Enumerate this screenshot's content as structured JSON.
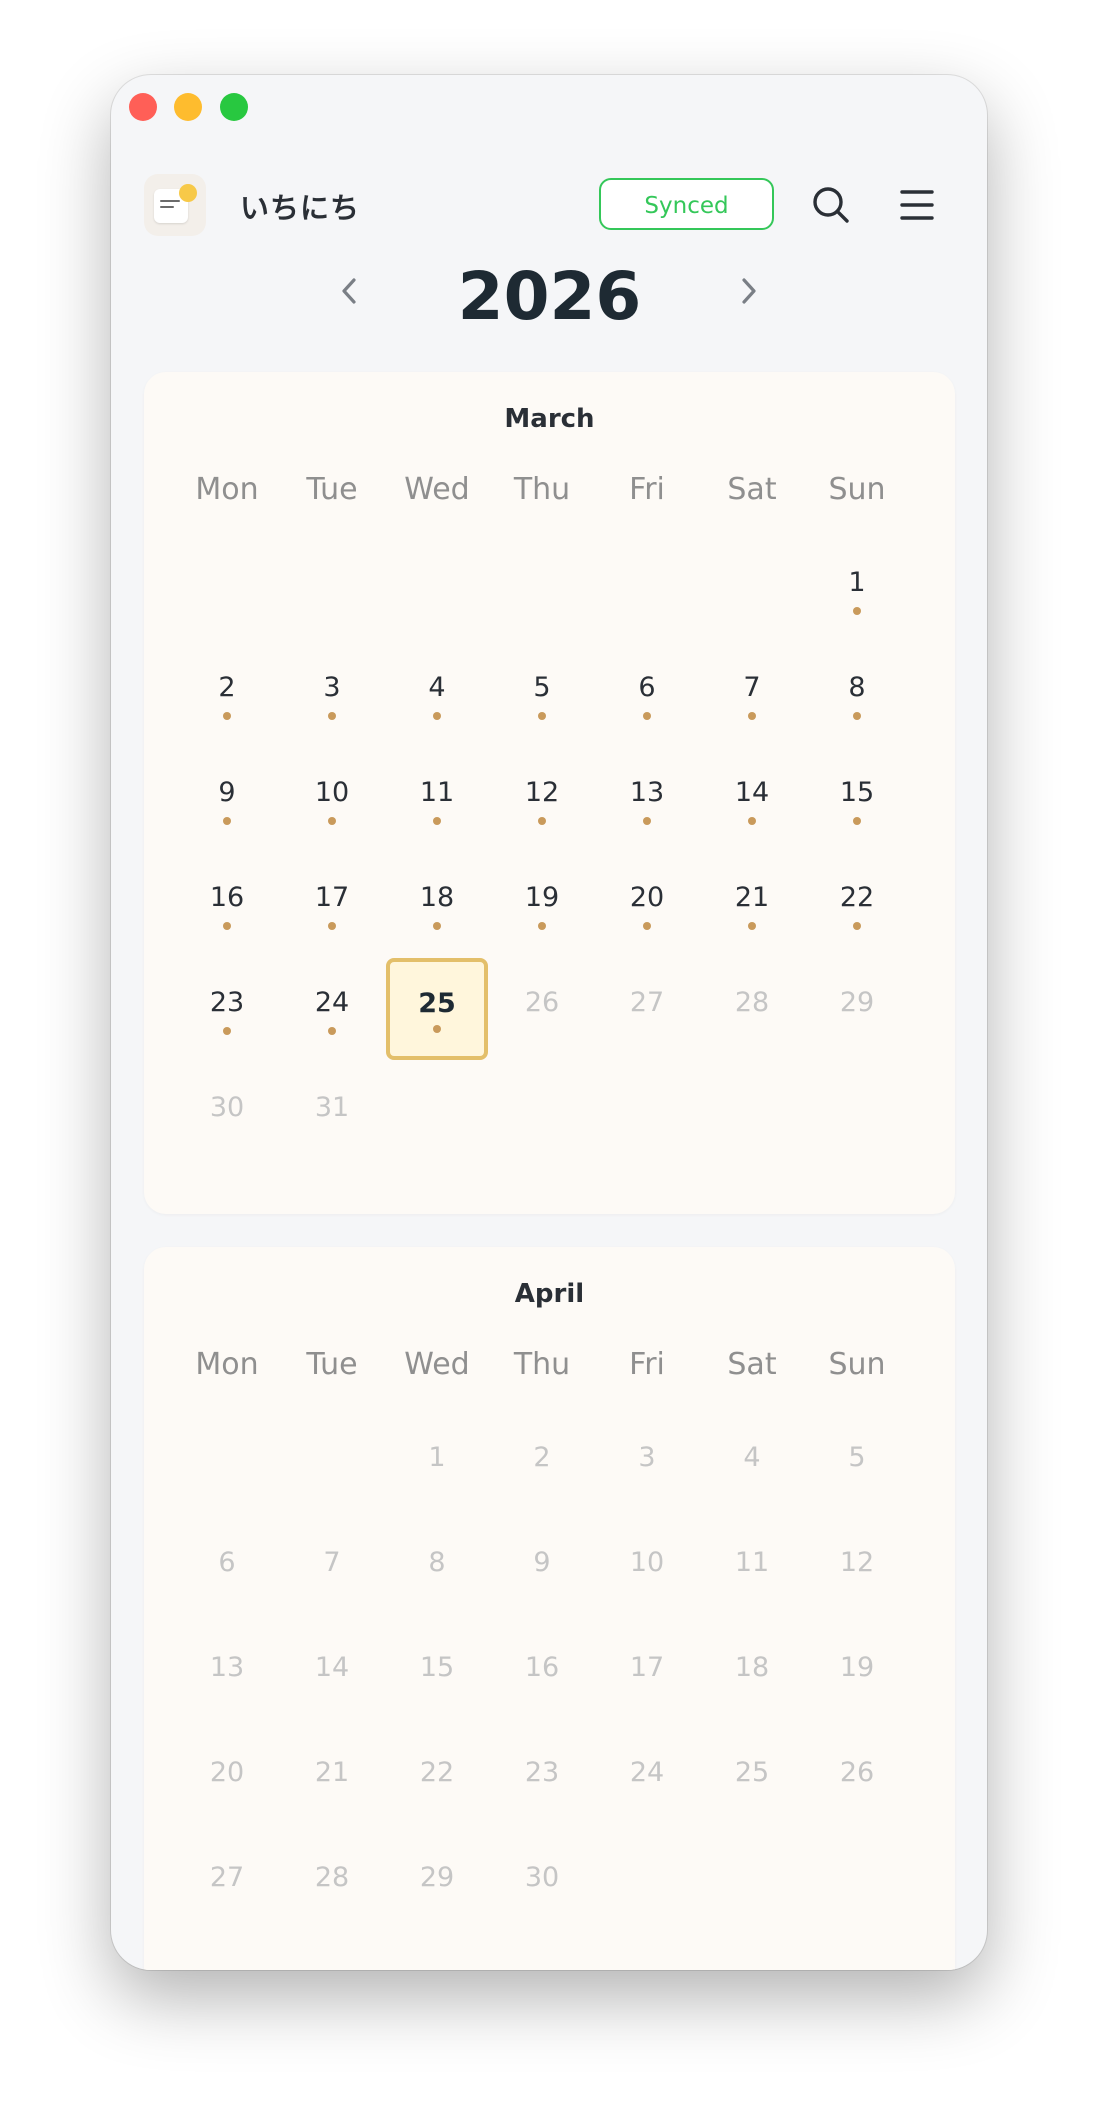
{
  "window": {
    "traffic_lights": [
      "close",
      "minimize",
      "maximize"
    ]
  },
  "header": {
    "app_name": "いちにち",
    "sync_status": "Synced",
    "search_icon": "search-icon",
    "menu_icon": "menu-icon",
    "colors": {
      "synced_accent": "#34c759"
    }
  },
  "year_nav": {
    "year": "2026",
    "prev_icon": "chevron-left-icon",
    "next_icon": "chevron-right-icon"
  },
  "weekdays": [
    "Mon",
    "Tue",
    "Wed",
    "Thu",
    "Fri",
    "Sat",
    "Sun"
  ],
  "months": [
    {
      "name": "March",
      "first_weekday_index": 6,
      "days_in_month": 31,
      "today": 25,
      "days_with_entries": [
        1,
        2,
        3,
        4,
        5,
        6,
        7,
        8,
        9,
        10,
        11,
        12,
        13,
        14,
        15,
        16,
        17,
        18,
        19,
        20,
        21,
        22,
        23,
        24,
        25
      ],
      "future_from": 26
    },
    {
      "name": "April",
      "first_weekday_index": 2,
      "days_in_month": 30,
      "today": null,
      "days_with_entries": [],
      "future_from": 1
    }
  ],
  "colors": {
    "entry_dot": "#c99a5b",
    "today_border": "#e3bf6a",
    "today_fill": "#fff6dc",
    "future_day_text": "#c5c5c5"
  }
}
